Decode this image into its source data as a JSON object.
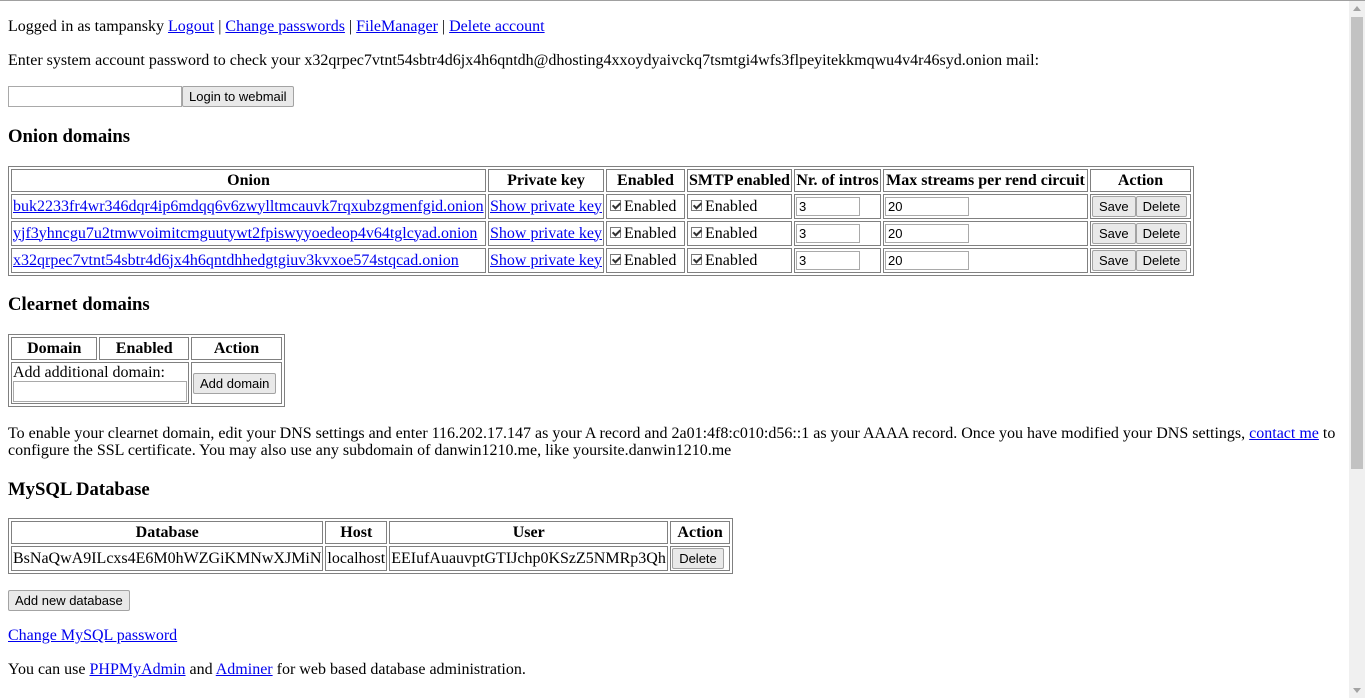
{
  "header": {
    "logged_in_text": "Logged in as tampansky",
    "links": [
      "Logout",
      "Change passwords",
      "FileManager",
      "Delete account"
    ],
    "separator": "|"
  },
  "webmail": {
    "prompt": "Enter system account password to check your x32qrpec7vtnt54sbtr4d6jx4h6qntdh@dhosting4xxoydyaivckq7tsmtgi4wfs3flpeyitekkmqwu4v4r46syd.onion mail:",
    "password_value": "",
    "login_button": "Login to webmail"
  },
  "onion": {
    "heading": "Onion domains",
    "columns": [
      "Onion",
      "Private key",
      "Enabled",
      "SMTP enabled",
      "Nr. of intros",
      "Max streams per rend circuit",
      "Action"
    ],
    "rows": [
      {
        "onion": "buk2233fr4wr346dqr4ip6mdqq6v6zwylltmcauvk7rqxubzgmenfgid.onion",
        "private_key": "Show private key",
        "enabled_label": "Enabled",
        "smtp_label": "Enabled",
        "intros": "3",
        "streams": "20",
        "save": "Save",
        "delete": "Delete"
      },
      {
        "onion": "yjf3yhncgu7u2tmwvoimitcmguutywt2fpiswyyoedeop4v64tglcyad.onion",
        "private_key": "Show private key",
        "enabled_label": "Enabled",
        "smtp_label": "Enabled",
        "intros": "3",
        "streams": "20",
        "save": "Save",
        "delete": "Delete"
      },
      {
        "onion": "x32qrpec7vtnt54sbtr4d6jx4h6qntdhhedgtgiuv3kvxoe574stqcad.onion",
        "private_key": "Show private key",
        "enabled_label": "Enabled",
        "smtp_label": "Enabled",
        "intros": "3",
        "streams": "20",
        "save": "Save",
        "delete": "Delete"
      }
    ]
  },
  "clearnet": {
    "heading": "Clearnet domains",
    "columns": [
      "Domain",
      "Enabled",
      "Action"
    ],
    "add_label": "Add additional domain:",
    "add_value": "",
    "add_button": "Add domain",
    "info_before": "To enable your clearnet domain, edit your DNS settings and enter 116.202.17.147 as your A record and 2a01:4f8:c010:d56::1 as your AAAA record. Once you have modified your DNS settings,",
    "contact_link": "contact me",
    "info_after": "to configure the SSL certificate. You may also use any subdomain of danwin1210.me, like yoursite.danwin1210.me"
  },
  "mysql": {
    "heading": "MySQL Database",
    "columns": [
      "Database",
      "Host",
      "User",
      "Action"
    ],
    "rows": [
      {
        "database": "BsNaQwA9ILcxs4E6M0hWZGiKMNwXJMiN",
        "host": "localhost",
        "user": "EEIufAuauvptGTIJchp0KSzZ5NMRp3Qh",
        "delete": "Delete"
      }
    ],
    "add_button": "Add new database",
    "change_password_link": "Change MySQL password",
    "admin_text_before": "You can use",
    "phpmyadmin_link": "PHPMyAdmin",
    "admin_and": "and",
    "adminer_link": "Adminer",
    "admin_text_after": "for web based database administration."
  }
}
